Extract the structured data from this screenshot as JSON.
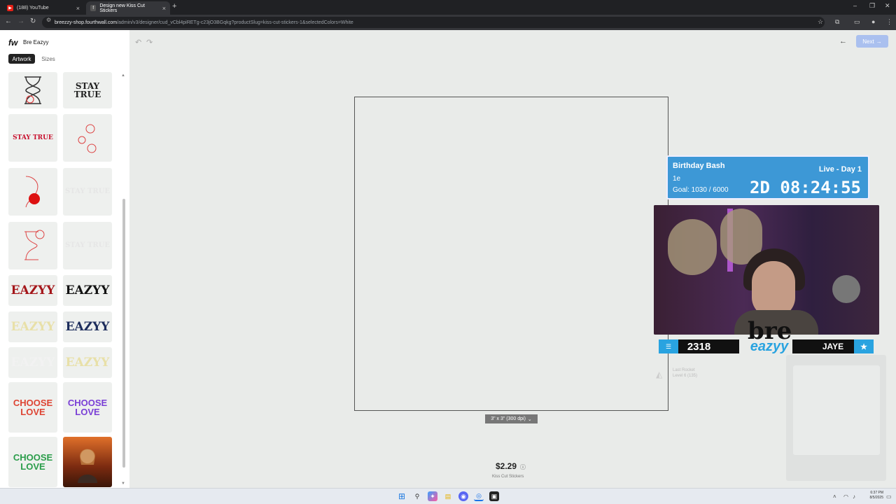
{
  "browser": {
    "tabs": [
      {
        "title": "(188) YouTube",
        "favicon": "youtube-icon",
        "active": false
      },
      {
        "title": "Design new Kiss Cut Stickers",
        "favicon": "fourthwall-icon",
        "active": true
      }
    ],
    "new_tab": "+",
    "address": {
      "host": "breezzy-shop.fourthwall.com",
      "path": "/admin/v3/designer/cud_vCbl4piRETg-c23jO3BGqkg?productSlug=kiss-cut-stickers-1&selectedColors=White"
    }
  },
  "designer": {
    "logo": "fw",
    "store_name": "Bre Eazyy",
    "tabs": [
      "Artwork",
      "Sizes"
    ],
    "artwork": [
      {
        "text": "",
        "desc": "hourglass-rose"
      },
      {
        "text": "STAY TRUE",
        "color": "#222"
      },
      {
        "text": "STAY TRUE",
        "color": "#c8102e"
      },
      {
        "text": "",
        "desc": "roses"
      },
      {
        "text": "",
        "desc": "rose-outline"
      },
      {
        "text": "STAY TRUE",
        "color": "#e6e6e6"
      },
      {
        "text": "",
        "desc": "hourglass-pink"
      },
      {
        "text": "STAY TRUE",
        "color": "#e6e6e6"
      },
      {
        "text": "EAZYY",
        "color": "#a4161a"
      },
      {
        "text": "EAZYY",
        "color": "#111"
      },
      {
        "text": "EAZYY",
        "color": "#e8e0a8"
      },
      {
        "text": "EAZYY",
        "color": "#1d2d5c"
      },
      {
        "text": "EAZYY",
        "color": "#f2f2f2"
      },
      {
        "text": "EAZYY",
        "color": "#e8e0a8"
      },
      {
        "text": "CHOOSE LOVE",
        "color": "rainbow"
      },
      {
        "text": "CHOOSE LOVE",
        "color": "rainbow"
      },
      {
        "text": "CHOOSE LOVE",
        "color": "rainbow"
      },
      {
        "text": "",
        "desc": "photo"
      }
    ],
    "size_option": "3\" x 3\" (300 dpi)",
    "price": "$2.29",
    "product_name": "Kiss Cut Stickers",
    "next_label": "Next"
  },
  "overlay": {
    "birthday": {
      "title": "Birthday Bash",
      "live": "Live - Day 1",
      "sub": "1e",
      "goal": "Goal: 1030 / 6000",
      "countdown": "2D 08:24:55"
    },
    "stats": {
      "count": "2318",
      "name": "JAYE"
    },
    "logo": {
      "top": "bre",
      "bottom": "eazyy"
    },
    "rocket": {
      "title": "Last Rocket",
      "level": "Level 6 (135)"
    }
  },
  "taskbar": {
    "time": "6:37 PM",
    "date": "8/5/2025"
  },
  "colors": {
    "accent": "#3d98d6",
    "next_button": "#aac0ef",
    "stream_blue": "#29a3e0"
  }
}
